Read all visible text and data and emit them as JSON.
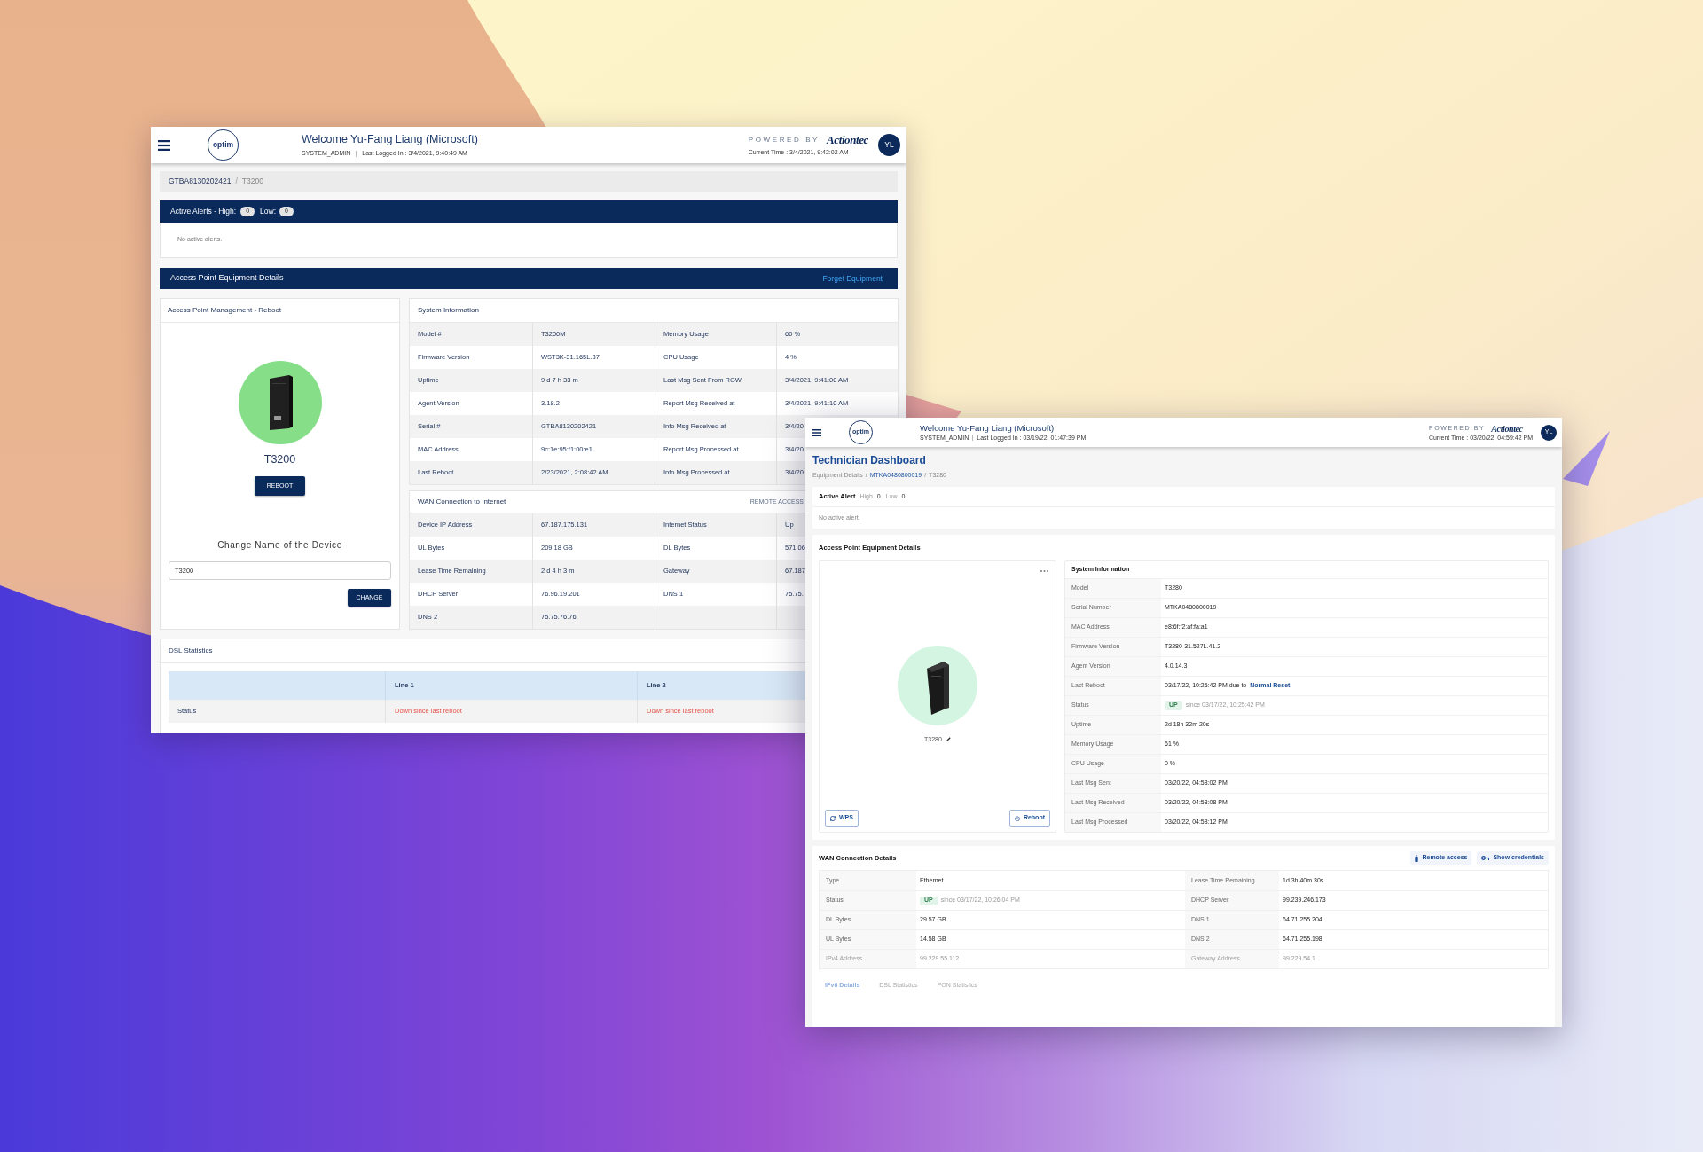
{
  "back_window": {
    "header": {
      "logo": "optim",
      "welcome": "Welcome Yu-Fang Liang (Microsoft)",
      "role": "SYSTEM_ADMIN",
      "last_logged_in": "Last Logged In : 3/4/2021, 9:40:49 AM",
      "powered_by": "POWERED BY",
      "brand": "Actiontec",
      "current_time": "Current Time : 3/4/2021, 9:42:02 AM",
      "avatar": "YL"
    },
    "breadcrumb": [
      {
        "kind": "link",
        "text": "GTBA8130202421"
      },
      {
        "kind": "separator",
        "text": "/"
      },
      {
        "kind": "current",
        "text": "T3200"
      }
    ],
    "alerts": {
      "title": "Active Alerts - High:",
      "high": "0",
      "low_label": "Low:",
      "low": "0",
      "message": "No active alerts."
    },
    "equipment_bar": {
      "title": "Access Point Equipment Details",
      "action": "Forget Equipment"
    },
    "management": {
      "title": "Access Point Management - Reboot",
      "device_name": "T3200",
      "reboot": "REBOOT",
      "rename_title": "Change Name of the Device",
      "rename_value": "T3200",
      "change": "CHANGE"
    },
    "system_info": {
      "title": "System Information",
      "rows": [
        [
          "Model #",
          "T3200M",
          "Memory Usage",
          "60 %"
        ],
        [
          "Firmware Version",
          "WST3K-31.165L.37",
          "CPU Usage",
          "4 %"
        ],
        [
          "Uptime",
          "9 d 7 h 33 m",
          "Last Msg Sent From RGW",
          "3/4/2021, 9:41:00 AM"
        ],
        [
          "Agent Version",
          "3.18.2",
          "Report Msg Received at",
          "3/4/2021, 9:41:10 AM"
        ],
        [
          "Serial #",
          "GTBA8130202421",
          "Info Msg Received at",
          "3/4/20"
        ],
        [
          "MAC Address",
          "9c:1e:95:f1:00:e1",
          "Report Msg Processed at",
          "3/4/20"
        ],
        [
          "Last Reboot",
          "2/23/2021, 2:08:42 AM",
          "Info Msg Processed at",
          "3/4/20"
        ]
      ]
    },
    "wan": {
      "title": "WAN Connection to Internet",
      "action": "REMOTE ACCESS",
      "rows": [
        [
          "Device IP Address",
          "67.187.175.131",
          "Internet Status",
          "Up"
        ],
        [
          "UL Bytes",
          "209.18 GB",
          "DL Bytes",
          "571.06"
        ],
        [
          "Lease Time Remaining",
          "2 d 4 h 3 m",
          "Gateway",
          "67.187"
        ],
        [
          "DHCP Server",
          "76.96.19.201",
          "DNS 1",
          "75.75."
        ],
        [
          "DNS 2",
          "75.75.76.76"
        ]
      ]
    },
    "dsl": {
      "title": "DSL Statistics",
      "columns": [
        "Line 1",
        "Line 2"
      ],
      "rows": [
        {
          "label": "Status",
          "down": true,
          "values": [
            "Down since last reboot",
            "Down since last reboot"
          ]
        }
      ]
    }
  },
  "front_window": {
    "header": {
      "logo": "optim",
      "welcome": "Welcome Yu-Fang Liang (Microsoft)",
      "role": "SYSTEM_ADMIN",
      "last_logged_in": "Last Logged In : 03/19/22, 01:47:39 PM",
      "powered_by": "POWERED BY",
      "brand": "Actiontec",
      "current_time": "Current Time : 03/20/22, 04:59:42 PM",
      "avatar": "YL"
    },
    "title": "Technician Dashboard",
    "breadcrumb": [
      {
        "kind": "plain",
        "text": "Equipment Details"
      },
      {
        "kind": "separator",
        "text": "/"
      },
      {
        "kind": "link",
        "text": "MTKA0480800019"
      },
      {
        "kind": "separator",
        "text": "/"
      },
      {
        "kind": "current",
        "text": "T3280"
      }
    ],
    "alert": {
      "title": "Active Alert",
      "high_label": "High",
      "high": "0",
      "low_label": "Low",
      "low": "0",
      "message": "No active alert."
    },
    "equipment": {
      "title": "Access Point Equipment Details",
      "device_name": "T3280",
      "buttons": [
        {
          "kind": "wps",
          "label": "WPS"
        },
        {
          "kind": "reboot",
          "label": "Reboot"
        }
      ],
      "system_info": {
        "title": "System Information",
        "rows": [
          {
            "kind": "text",
            "label": "Model",
            "value": "T3280"
          },
          {
            "kind": "text",
            "label": "Serial Number",
            "value": "MTKA0480800019"
          },
          {
            "kind": "text",
            "label": "MAC Address",
            "value": "e8:6f:f2:af:fa:a1"
          },
          {
            "kind": "text",
            "label": "Firmware Version",
            "value": "T3280-31.527L.41.2"
          },
          {
            "kind": "text",
            "label": "Agent Version",
            "value": "4.0.14.3"
          },
          {
            "kind": "link",
            "label": "Last Reboot",
            "value": "03/17/22, 10:25:42 PM due to",
            "link": "Normal Reset"
          },
          {
            "kind": "status",
            "label": "Status",
            "badge": "UP",
            "note": "since 03/17/22, 10:25:42 PM"
          },
          {
            "kind": "text",
            "label": "Uptime",
            "value": "2d 18h 32m 20s"
          },
          {
            "kind": "text",
            "label": "Memory Usage",
            "value": "61 %"
          },
          {
            "kind": "text",
            "label": "CPU Usage",
            "value": "0 %"
          },
          {
            "kind": "text",
            "label": "Last Msg Sent",
            "value": "03/20/22, 04:58:02 PM"
          },
          {
            "kind": "text",
            "label": "Last Msg Received",
            "value": "03/20/22, 04:58:08 PM"
          },
          {
            "kind": "text",
            "label": "Last Msg Processed",
            "value": "03/20/22, 04:58:12 PM"
          }
        ]
      }
    },
    "wan": {
      "title": "WAN Connection Details",
      "actions": [
        {
          "kind": "remote",
          "label": "Remote access"
        },
        {
          "kind": "credentials",
          "label": "Show credentials"
        }
      ],
      "rows": [
        {
          "dimmed": false,
          "cells": [
            {
              "kind": "text",
              "label": "Type",
              "value": "Ethernet"
            },
            {
              "kind": "text",
              "label": "Lease Time Remaining",
              "value": "1d 3h 40m 30s"
            }
          ]
        },
        {
          "dimmed": false,
          "cells": [
            {
              "kind": "status",
              "label": "Status",
              "badge": "UP",
              "note": "since 03/17/22, 10:26:04 PM"
            },
            {
              "kind": "text",
              "label": "DHCP Server",
              "value": "99.239.246.173"
            }
          ]
        },
        {
          "dimmed": false,
          "cells": [
            {
              "kind": "text",
              "label": "DL Bytes",
              "value": "29.57 GB"
            },
            {
              "kind": "text",
              "label": "DNS 1",
              "value": "64.71.255.204"
            }
          ]
        },
        {
          "dimmed": false,
          "cells": [
            {
              "kind": "text",
              "label": "UL Bytes",
              "value": "14.58 GB"
            },
            {
              "kind": "text",
              "label": "DNS 2",
              "value": "64.71.255.198"
            }
          ]
        },
        {
          "dimmed": true,
          "cells": [
            {
              "kind": "text",
              "label": "IPv4 Address",
              "value": "99.229.55.112"
            },
            {
              "kind": "text",
              "label": "Gateway Address",
              "value": "99.229.54.1"
            }
          ]
        }
      ],
      "tabs": [
        {
          "label": "IPv6 Details",
          "selected": true
        },
        {
          "label": "DSL Statistics",
          "selected": false
        },
        {
          "label": "PON Statistics",
          "selected": false
        }
      ]
    }
  }
}
